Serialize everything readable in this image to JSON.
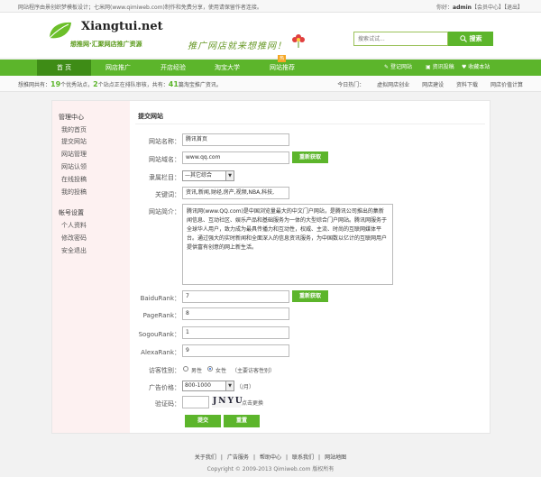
{
  "topbar": {
    "left_text": "网站程序由景创织梦模板设计；七米网(www.qimiweb.com)制作和免费分享，使用请保留作者连接。",
    "greeting": "你好：",
    "username": "admin",
    "member_center": "【会员中心】",
    "logout": "【退出】"
  },
  "header": {
    "logo_text": "Xiangtui.net",
    "slogan": "想推网·汇聚网店推广资源",
    "banner_text": "推广网店就来想推网！",
    "search_placeholder": "搜索试试...",
    "search_button": "搜索"
  },
  "nav": {
    "items": [
      {
        "label": "首 页"
      },
      {
        "label": "网店推广"
      },
      {
        "label": "开店经验"
      },
      {
        "label": "淘宝大学"
      },
      {
        "label": "网站推荐"
      }
    ],
    "hot_badge": "热",
    "right": [
      {
        "label": "登记网站"
      },
      {
        "label": "资讯投稿"
      },
      {
        "label": "收藏本站"
      }
    ]
  },
  "subbar": {
    "stats_prefix": "想推网共有：",
    "sites_count": "19",
    "sites_text": "个优秀站点，",
    "pending_count": "2",
    "pending_text": "个站点正在排队审核，共有：",
    "articles_count": "41",
    "articles_text": "篇淘宝推广资讯。",
    "today": "今日热门：",
    "links": [
      "虚拟网店创业",
      "网店建设",
      "资料下载",
      "网店价值计算"
    ]
  },
  "sidebar": {
    "manage_title": "管理中心",
    "manage_items": [
      "我的首页",
      "提交网站",
      "网站管理",
      "网站认领",
      "在线投稿",
      "我的投稿"
    ],
    "account_title": "帐号设置",
    "account_items": [
      "个人资料",
      "修改密码",
      "安全退出"
    ]
  },
  "form": {
    "title": "提交网站",
    "site_name_label": "网站名称：",
    "site_name": "腾讯首页",
    "domain_label": "网站域名：",
    "domain": "www.qq.com",
    "refetch": "重新获取",
    "category_label": "隶属栏目：",
    "category": "—其它综合",
    "keywords_label": "关键词：",
    "keywords": "资讯,新闻,财经,房产,视频,NBA,科技,",
    "intro_label": "网站简介：",
    "intro": "腾讯网(www.QQ.com)是中国浏览量最大的中文门户网站，是腾讯公司推出的集新闻信息、互动社区、娱乐产品和基础服务为一体的大型综合门户网站。腾讯网服务于全球华人用户，致力成为最具传播力和互动性，权威、主流、时尚的互联网媒体平台。通过强大的实时新闻和全面深入的信息资讯服务，为中国数以亿计的互联网用户提供富有创意的网上新生活。",
    "baidu_label": "BaiduRank：",
    "baidu": "7",
    "refetch2": "重新获取",
    "pr_label": "PageRank：",
    "pr": "8",
    "sogou_label": "SogouRank：",
    "sogou": "1",
    "alexa_label": "AlexaRank：",
    "alexa": "9",
    "gender_label": "访客性别：",
    "male": "男性",
    "female": "女性",
    "gender_note": "（主要访客性别）",
    "ad_price_label": "广告价格：",
    "ad_price": "800-1000",
    "per_month": "（/月）",
    "captcha_label": "验证码：",
    "captcha": "JNYU",
    "captcha_refresh": "点击更换",
    "submit": "提交",
    "reset": "重置"
  },
  "footer": {
    "links": [
      "关于我们",
      "广告服务",
      "帮助中心",
      "联系我们",
      "网站地图"
    ],
    "copyright": "Copyright © 2009-2013 Qimiweb.com 版权所有"
  },
  "colors": {
    "brand_green": "#5cb52b",
    "nav_active": "#3e8c16",
    "sidebar_bg": "#fdf1f1"
  }
}
